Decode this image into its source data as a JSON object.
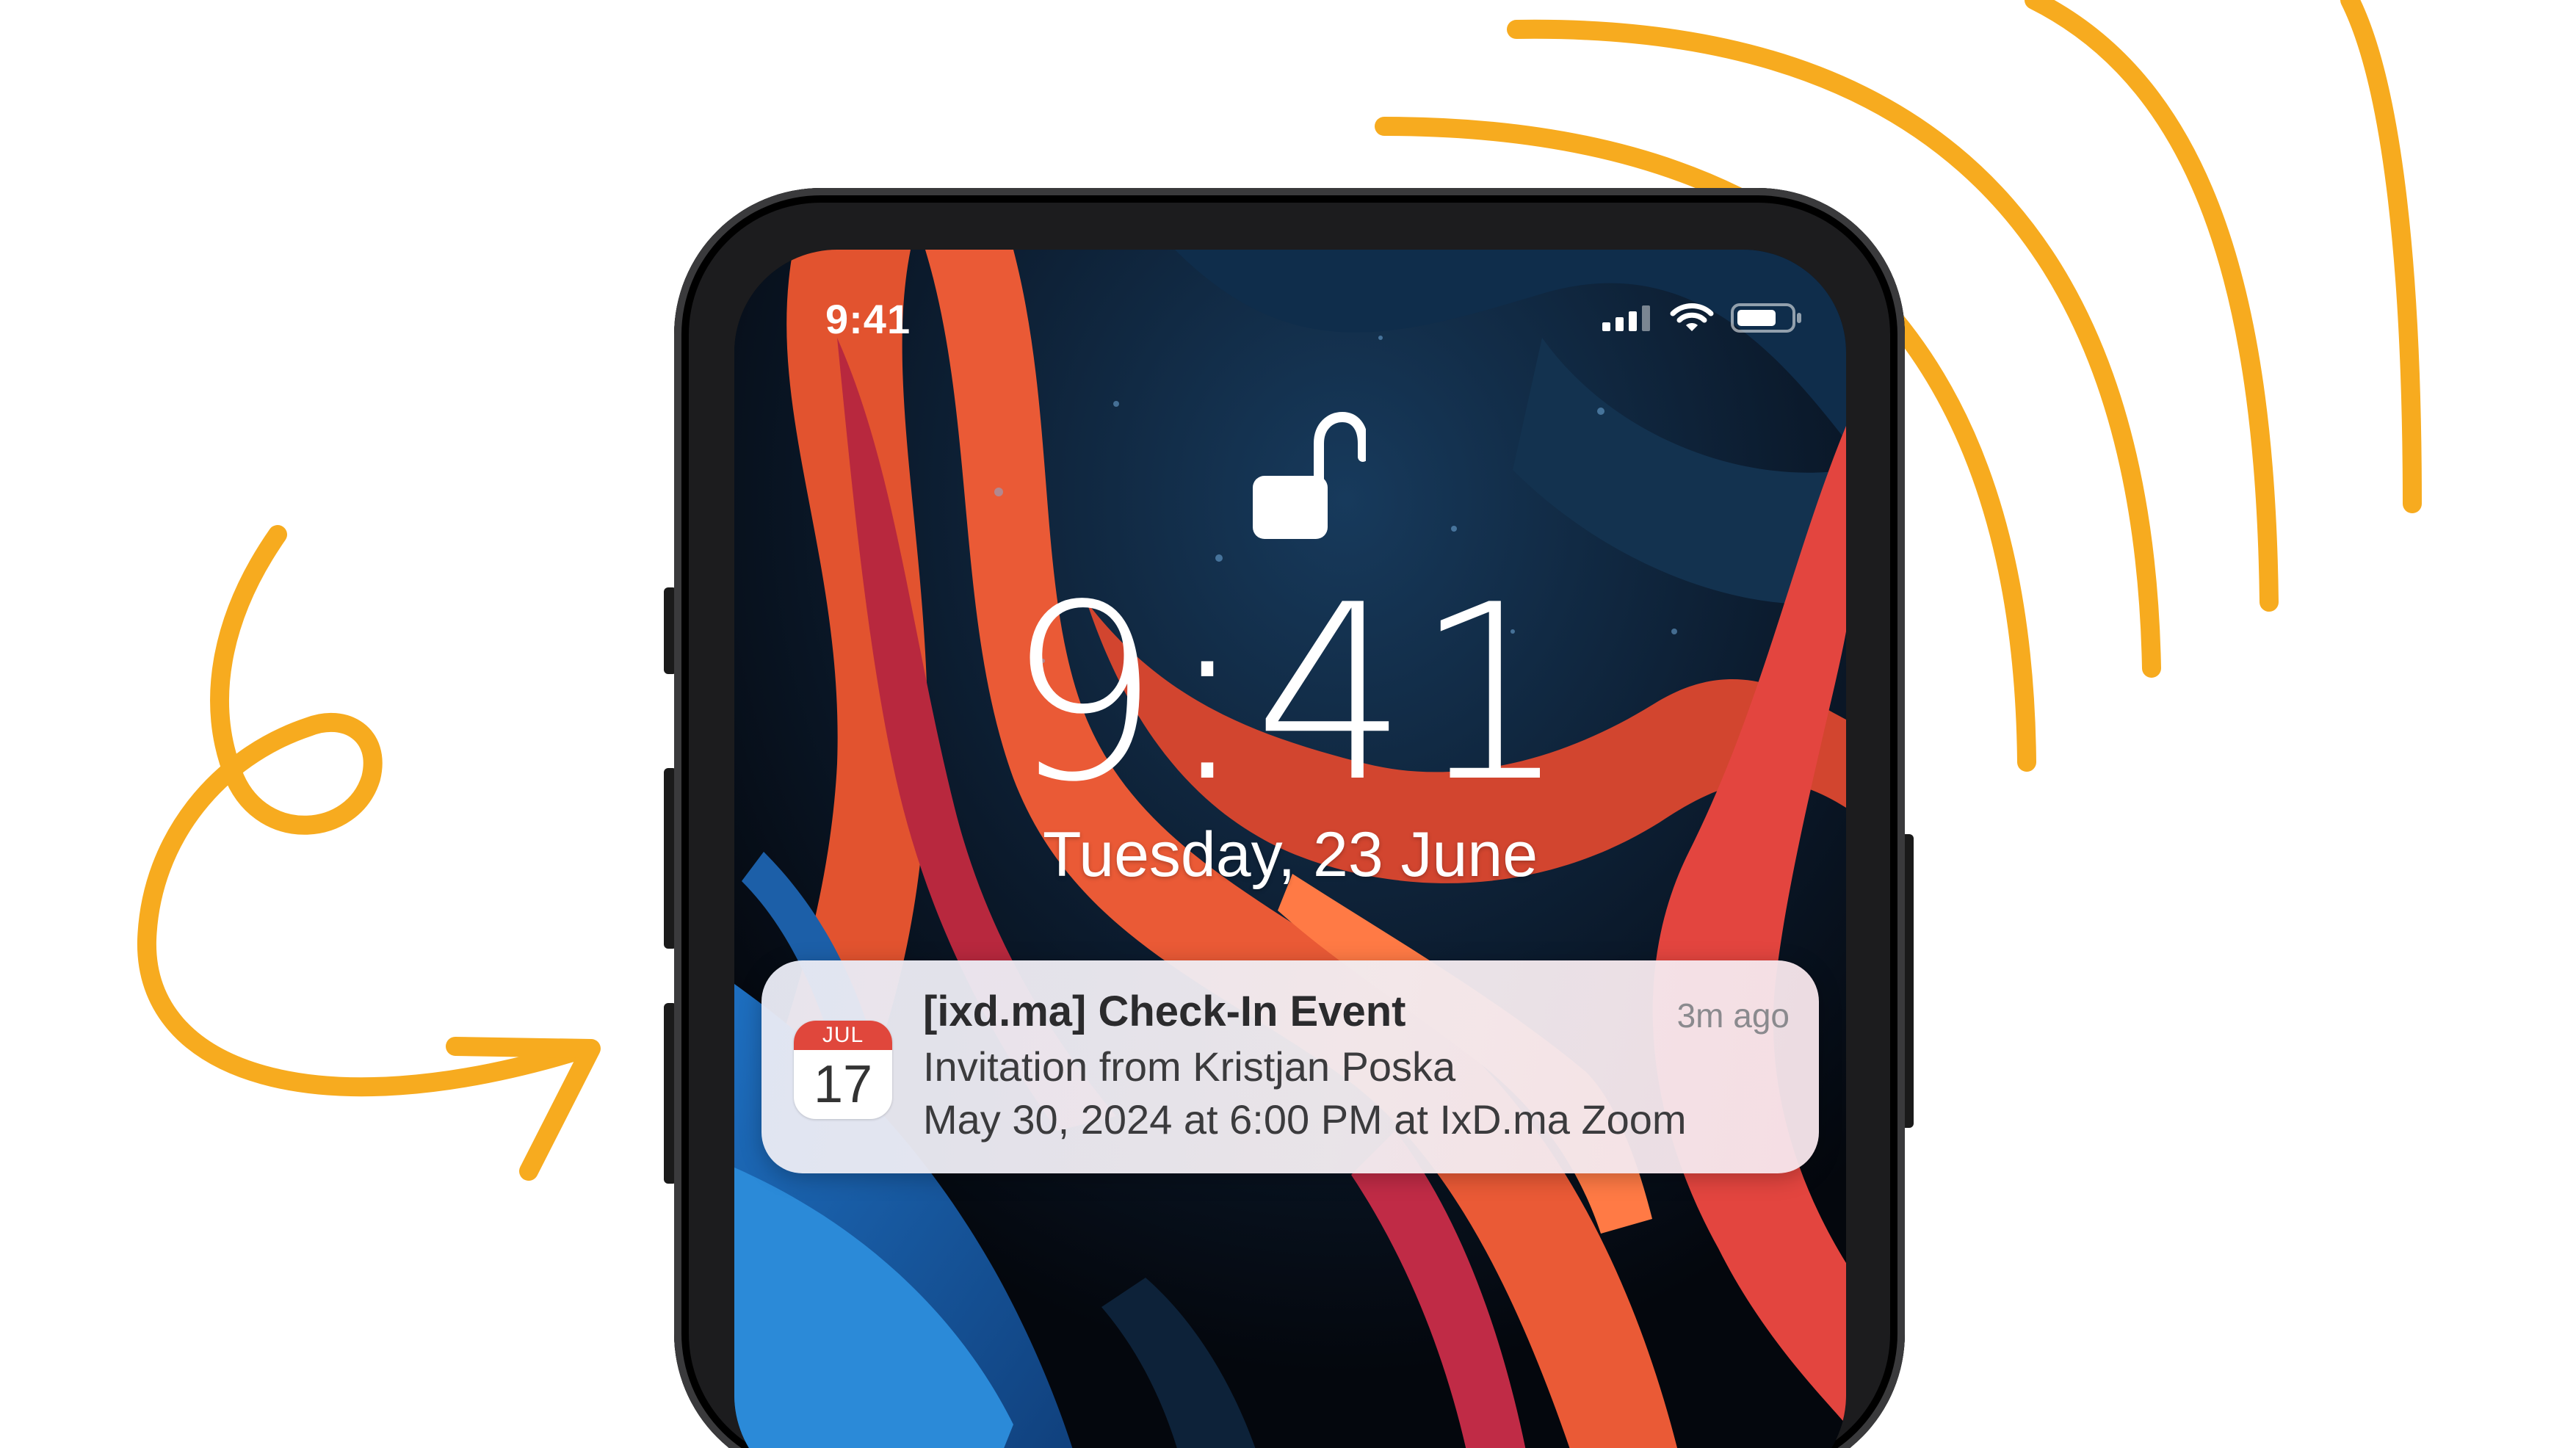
{
  "status_bar": {
    "time": "9:41",
    "icons": [
      "cellular-signal-icon",
      "wifi-icon",
      "battery-icon"
    ]
  },
  "lock_screen": {
    "lock_icon": "unlocked-padlock-icon",
    "time": "9:41",
    "date": "Tuesday,  23 June"
  },
  "notification": {
    "app_icon": "calendar-icon",
    "icon_month": "JUL",
    "icon_day": "17",
    "title": "[ixd.ma] Check-In Event",
    "time_ago": "3m ago",
    "line1": "Invitation from Kristjan Poska",
    "line2": "May 30, 2024 at 6:00 PM at IxD.ma Zoom"
  },
  "colors": {
    "accent_stroke": "#F7AB1F",
    "calendar_red": "#E0473C",
    "notification_bg": "#EEEAF1"
  }
}
